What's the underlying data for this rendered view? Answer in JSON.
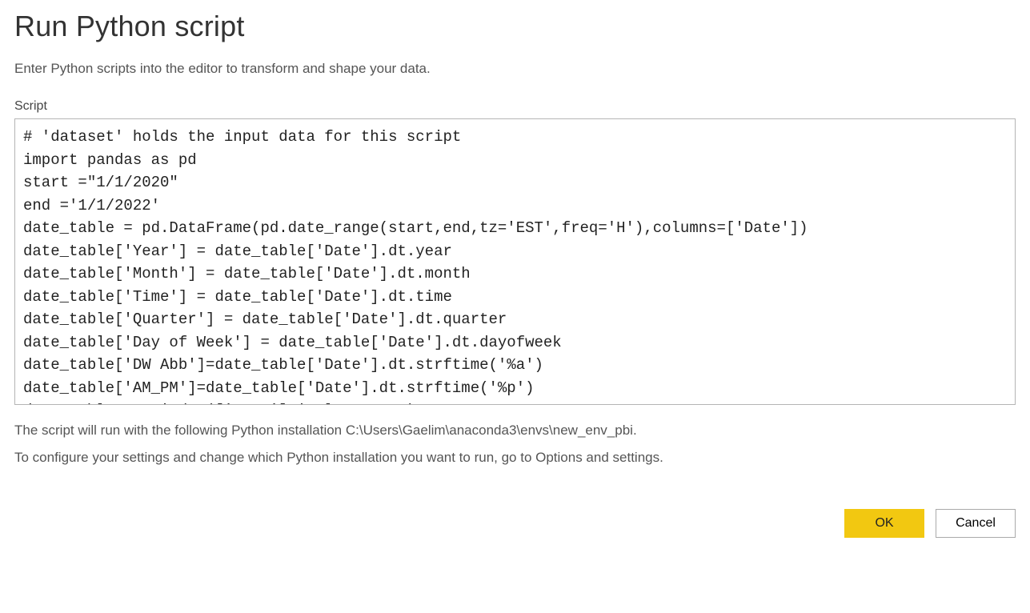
{
  "dialog": {
    "title": "Run Python script",
    "subtitle": "Enter Python scripts into the editor to transform and shape your data.",
    "script_label": "Script",
    "script_content": "# 'dataset' holds the input data for this script\nimport pandas as pd\nstart =\"1/1/2020\"\nend ='1/1/2022'\ndate_table = pd.DataFrame(pd.date_range(start,end,tz='EST',freq='H'),columns=['Date'])\ndate_table['Year'] = date_table['Date'].dt.year\ndate_table['Month'] = date_table['Date'].dt.month\ndate_table['Time'] = date_table['Date'].dt.time\ndate_table['Quarter'] = date_table['Date'].dt.quarter\ndate_table['Day of Week'] = date_table['Date'].dt.dayofweek\ndate_table['DW Abb']=date_table['Date'].dt.strftime('%a')\ndate_table['AM_PM']=date_table['Date'].dt.strftime('%p')\ndate_table.set_index(['Date'],inplace=True)",
    "install_info": "The script will run with the following Python installation C:\\Users\\Gaelim\\anaconda3\\envs\\new_env_pbi.",
    "configure_info": "To configure your settings and change which Python installation you want to run, go to Options and settings.",
    "buttons": {
      "ok": "OK",
      "cancel": "Cancel"
    }
  }
}
